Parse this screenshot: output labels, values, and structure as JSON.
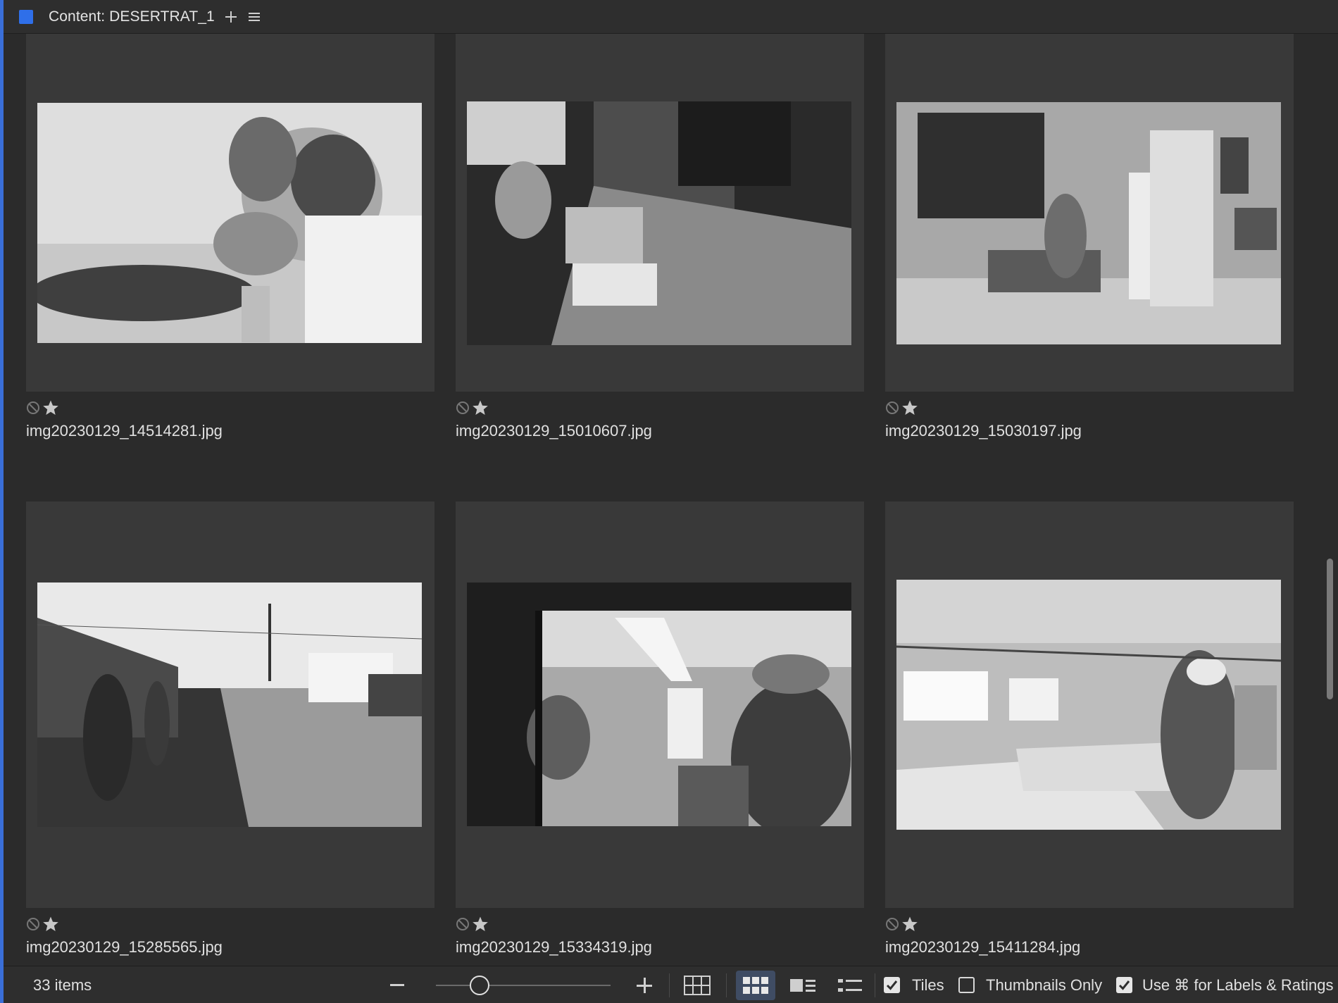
{
  "panel": {
    "title": "Content: DESERTRAT_1",
    "add_icon": "plus-icon",
    "menu_icon": "hamburger-menu-icon"
  },
  "tiles": [
    {
      "filename": "img20230129_14514281.jpg",
      "reject_icon": "reject-icon",
      "rating_icon": "star-icon"
    },
    {
      "filename": "img20230129_15010607.jpg",
      "reject_icon": "reject-icon",
      "rating_icon": "star-icon"
    },
    {
      "filename": "img20230129_15030197.jpg",
      "reject_icon": "reject-icon",
      "rating_icon": "star-icon"
    },
    {
      "filename": "img20230129_15285565.jpg",
      "reject_icon": "reject-icon",
      "rating_icon": "star-icon"
    },
    {
      "filename": "img20230129_15334319.jpg",
      "reject_icon": "reject-icon",
      "rating_icon": "star-icon"
    },
    {
      "filename": "img20230129_15411284.jpg",
      "reject_icon": "reject-icon",
      "rating_icon": "star-icon"
    }
  ],
  "footer": {
    "item_count": "33 items",
    "zoom_level": 0.25,
    "view_modes": [
      "grid-view-icon",
      "thumbnail-view-icon",
      "details-view-icon",
      "list-view-icon"
    ],
    "active_view": "thumbnail-view-icon",
    "tiles_label": "Tiles",
    "tiles_checked": true,
    "thumbnails_only_label": "Thumbnails Only",
    "thumbnails_only_checked": false,
    "labels_ratings_label": "Use ⌘ for Labels & Ratings",
    "labels_ratings_checked": true
  },
  "colors": {
    "accent": "#2f6fe9",
    "panel_bg": "#2b2b2b",
    "tile_bg": "#393939",
    "active_view_bg": "#3f4c63"
  }
}
